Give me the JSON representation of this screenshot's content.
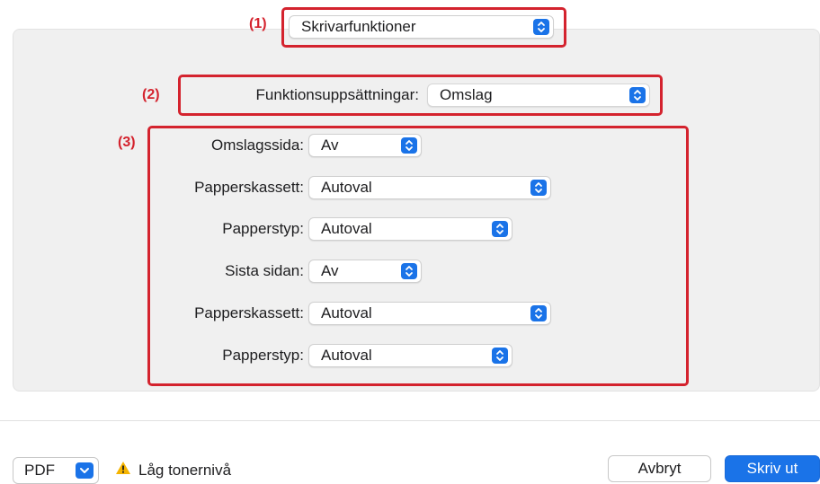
{
  "callouts": [
    "(1)",
    "(2)",
    "(3)"
  ],
  "top_menu": {
    "value": "Skrivarfunktioner"
  },
  "feature_set": {
    "label": "Funktionsuppsättningar:",
    "value": "Omslag"
  },
  "rows": [
    {
      "label": "Omslagssida:",
      "value": "Av"
    },
    {
      "label": "Papperskassett:",
      "value": "Autoval"
    },
    {
      "label": "Papperstyp:",
      "value": "Autoval"
    },
    {
      "label": "Sista sidan:",
      "value": "Av"
    },
    {
      "label": "Papperskassett:",
      "value": "Autoval"
    },
    {
      "label": "Papperstyp:",
      "value": "Autoval"
    }
  ],
  "footer": {
    "pdf_label": "PDF",
    "warning_text": "Låg tonernivå",
    "cancel_label": "Avbryt",
    "print_label": "Skriv ut"
  },
  "colors": {
    "accent": "#1a73e8",
    "callout_red": "#d4232e",
    "warning_yellow": "#f5b400"
  },
  "icons": {
    "stepper": "up-down-chevron-icon",
    "pdf_menu": "chevron-down-icon",
    "warning": "warning-triangle-icon"
  }
}
